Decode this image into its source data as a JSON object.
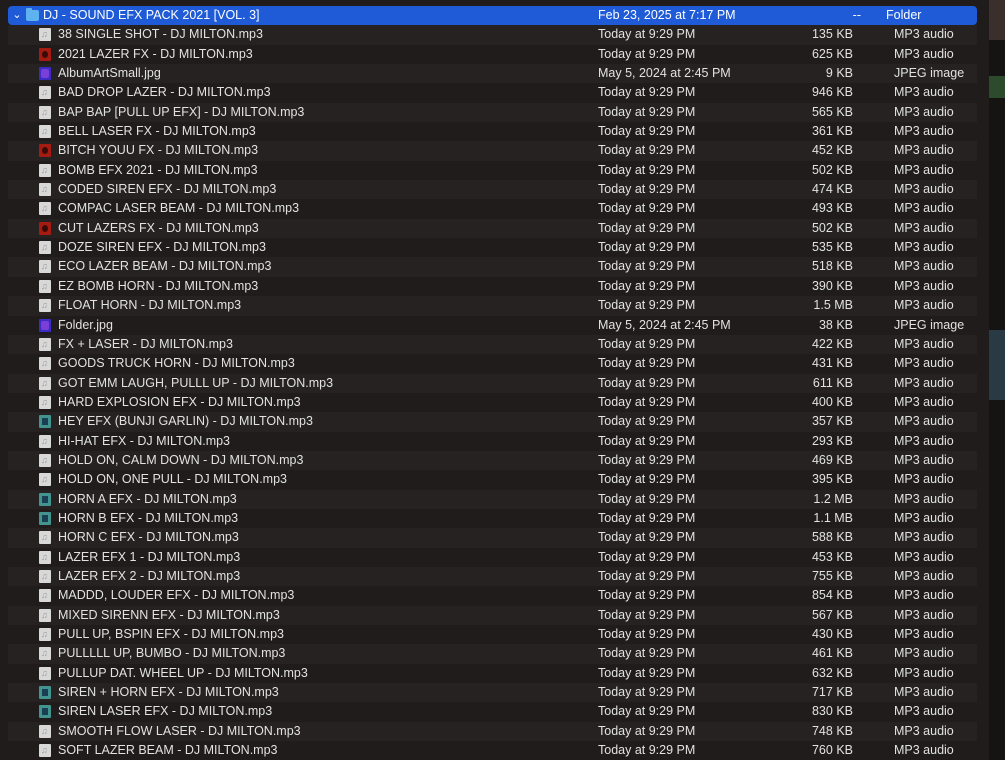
{
  "folder": {
    "name": "DJ  - SOUND EFX PACK 2021 [VOL. 3]",
    "date": "Feb 23, 2025 at 7:17 PM",
    "size": "--",
    "kind": "Folder"
  },
  "files": [
    {
      "name": "38 SINGLE SHOT - DJ MILTON.mp3",
      "date": "Today at 9:29 PM",
      "size": "135 KB",
      "kind": "MP3 audio",
      "icon": "generic"
    },
    {
      "name": "2021 LAZER FX - DJ MILTON.mp3",
      "date": "Today at 9:29 PM",
      "size": "625 KB",
      "kind": "MP3 audio",
      "icon": "red"
    },
    {
      "name": "AlbumArtSmall.jpg",
      "date": "May 5, 2024 at 2:45 PM",
      "size": "9 KB",
      "kind": "JPEG image",
      "icon": "purple"
    },
    {
      "name": "BAD DROP LAZER - DJ MILTON.mp3",
      "date": "Today at 9:29 PM",
      "size": "946 KB",
      "kind": "MP3 audio",
      "icon": "generic"
    },
    {
      "name": "BAP BAP [PULL UP EFX] - DJ MILTON.mp3",
      "date": "Today at 9:29 PM",
      "size": "565 KB",
      "kind": "MP3 audio",
      "icon": "generic"
    },
    {
      "name": "BELL LASER FX - DJ MILTON.mp3",
      "date": "Today at 9:29 PM",
      "size": "361 KB",
      "kind": "MP3 audio",
      "icon": "generic"
    },
    {
      "name": "BITCH YOUU FX - DJ MILTON.mp3",
      "date": "Today at 9:29 PM",
      "size": "452 KB",
      "kind": "MP3 audio",
      "icon": "red"
    },
    {
      "name": "BOMB EFX 2021 - DJ MILTON.mp3",
      "date": "Today at 9:29 PM",
      "size": "502 KB",
      "kind": "MP3 audio",
      "icon": "generic"
    },
    {
      "name": "CODED SIREN EFX - DJ MILTON.mp3",
      "date": "Today at 9:29 PM",
      "size": "474 KB",
      "kind": "MP3 audio",
      "icon": "generic"
    },
    {
      "name": "COMPAC LASER BEAM - DJ MILTON.mp3",
      "date": "Today at 9:29 PM",
      "size": "493 KB",
      "kind": "MP3 audio",
      "icon": "generic"
    },
    {
      "name": "CUT LAZERS FX - DJ MILTON.mp3",
      "date": "Today at 9:29 PM",
      "size": "502 KB",
      "kind": "MP3 audio",
      "icon": "red"
    },
    {
      "name": "DOZE SIREN EFX - DJ MILTON.mp3",
      "date": "Today at 9:29 PM",
      "size": "535 KB",
      "kind": "MP3 audio",
      "icon": "generic"
    },
    {
      "name": "ECO LAZER BEAM - DJ MILTON.mp3",
      "date": "Today at 9:29 PM",
      "size": "518 KB",
      "kind": "MP3 audio",
      "icon": "generic"
    },
    {
      "name": "EZ BOMB HORN - DJ MILTON.mp3",
      "date": "Today at 9:29 PM",
      "size": "390 KB",
      "kind": "MP3 audio",
      "icon": "generic"
    },
    {
      "name": "FLOAT HORN - DJ MILTON.mp3",
      "date": "Today at 9:29 PM",
      "size": "1.5 MB",
      "kind": "MP3 audio",
      "icon": "generic"
    },
    {
      "name": "Folder.jpg",
      "date": "May 5, 2024 at 2:45 PM",
      "size": "38 KB",
      "kind": "JPEG image",
      "icon": "purple"
    },
    {
      "name": "FX + LASER - DJ MILTON.mp3",
      "date": "Today at 9:29 PM",
      "size": "422 KB",
      "kind": "MP3 audio",
      "icon": "generic"
    },
    {
      "name": "GOODS TRUCK HORN - DJ MILTON.mp3",
      "date": "Today at 9:29 PM",
      "size": "431 KB",
      "kind": "MP3 audio",
      "icon": "generic"
    },
    {
      "name": "GOT EMM LAUGH, PULLL UP - DJ MILTON.mp3",
      "date": "Today at 9:29 PM",
      "size": "611 KB",
      "kind": "MP3 audio",
      "icon": "generic"
    },
    {
      "name": "HARD EXPLOSION EFX - DJ MILTON.mp3",
      "date": "Today at 9:29 PM",
      "size": "400 KB",
      "kind": "MP3 audio",
      "icon": "generic"
    },
    {
      "name": "HEY EFX (BUNJI GARLIN) - DJ MILTON.mp3",
      "date": "Today at 9:29 PM",
      "size": "357 KB",
      "kind": "MP3 audio",
      "icon": "teal"
    },
    {
      "name": "HI-HAT EFX - DJ MILTON.mp3",
      "date": "Today at 9:29 PM",
      "size": "293 KB",
      "kind": "MP3 audio",
      "icon": "generic"
    },
    {
      "name": "HOLD ON, CALM DOWN - DJ MILTON.mp3",
      "date": "Today at 9:29 PM",
      "size": "469 KB",
      "kind": "MP3 audio",
      "icon": "generic"
    },
    {
      "name": "HOLD ON, ONE PULL - DJ MILTON.mp3",
      "date": "Today at 9:29 PM",
      "size": "395 KB",
      "kind": "MP3 audio",
      "icon": "generic"
    },
    {
      "name": "HORN A EFX - DJ MILTON.mp3",
      "date": "Today at 9:29 PM",
      "size": "1.2 MB",
      "kind": "MP3 audio",
      "icon": "teal"
    },
    {
      "name": "HORN B EFX - DJ MILTON.mp3",
      "date": "Today at 9:29 PM",
      "size": "1.1 MB",
      "kind": "MP3 audio",
      "icon": "teal"
    },
    {
      "name": "HORN C EFX - DJ MILTON.mp3",
      "date": "Today at 9:29 PM",
      "size": "588 KB",
      "kind": "MP3 audio",
      "icon": "generic"
    },
    {
      "name": "LAZER EFX 1 - DJ MILTON.mp3",
      "date": "Today at 9:29 PM",
      "size": "453 KB",
      "kind": "MP3 audio",
      "icon": "generic"
    },
    {
      "name": "LAZER EFX 2 - DJ MILTON.mp3",
      "date": "Today at 9:29 PM",
      "size": "755 KB",
      "kind": "MP3 audio",
      "icon": "generic"
    },
    {
      "name": "MADDD, LOUDER EFX - DJ MILTON.mp3",
      "date": "Today at 9:29 PM",
      "size": "854 KB",
      "kind": "MP3 audio",
      "icon": "generic"
    },
    {
      "name": "MIXED SIRENN EFX - DJ MILTON.mp3",
      "date": "Today at 9:29 PM",
      "size": "567 KB",
      "kind": "MP3 audio",
      "icon": "generic"
    },
    {
      "name": "PULL UP, BSPIN EFX - DJ MILTON.mp3",
      "date": "Today at 9:29 PM",
      "size": "430 KB",
      "kind": "MP3 audio",
      "icon": "generic"
    },
    {
      "name": "PULLLLL UP, BUMBO - DJ MILTON.mp3",
      "date": "Today at 9:29 PM",
      "size": "461 KB",
      "kind": "MP3 audio",
      "icon": "generic"
    },
    {
      "name": "PULLUP DAT. WHEEL UP - DJ MILTON.mp3",
      "date": "Today at 9:29 PM",
      "size": "632 KB",
      "kind": "MP3 audio",
      "icon": "generic"
    },
    {
      "name": "SIREN + HORN EFX - DJ MILTON.mp3",
      "date": "Today at 9:29 PM",
      "size": "717 KB",
      "kind": "MP3 audio",
      "icon": "teal"
    },
    {
      "name": "SIREN LASER EFX - DJ MILTON.mp3",
      "date": "Today at 9:29 PM",
      "size": "830 KB",
      "kind": "MP3 audio",
      "icon": "teal"
    },
    {
      "name": "SMOOTH FLOW LASER - DJ MILTON.mp3",
      "date": "Today at 9:29 PM",
      "size": "748 KB",
      "kind": "MP3 audio",
      "icon": "generic"
    },
    {
      "name": "SOFT LAZER BEAM - DJ MILTON.mp3",
      "date": "Today at 9:29 PM",
      "size": "760 KB",
      "kind": "MP3 audio",
      "icon": "generic"
    }
  ],
  "colors": {
    "selection": "#1f5bd6",
    "background": "#1f1c1b",
    "row_alt": "#252221",
    "text": "#e2e2e2"
  }
}
